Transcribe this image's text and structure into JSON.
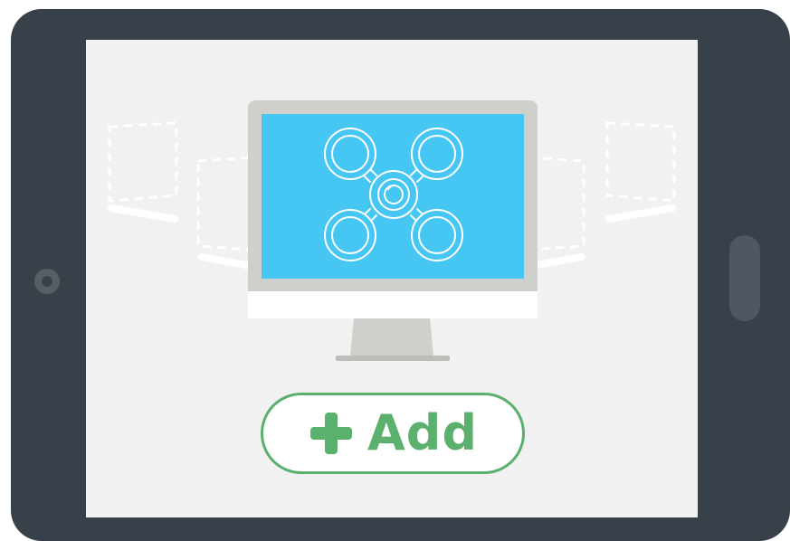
{
  "add_button": {
    "label": "Add",
    "icon": "plus-icon"
  },
  "center_display": {
    "icon": "drone-icon"
  },
  "colors": {
    "device_frame": "#384049",
    "screen_background": "#f0f1f0",
    "monitor_screen": "#46c6f2",
    "accent_green": "#5ab06c"
  }
}
